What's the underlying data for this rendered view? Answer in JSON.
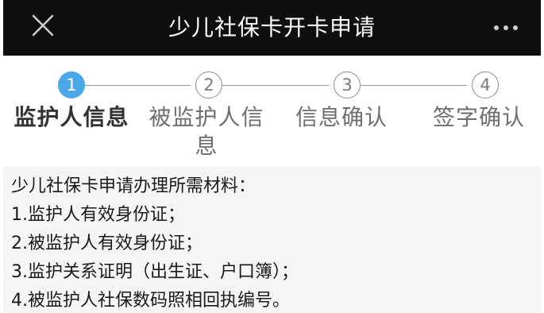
{
  "header": {
    "title": "少儿社保卡开卡申请",
    "close_icon": "close-icon",
    "more_icon": "more-horizontal-icon",
    "background": "#0f0f10"
  },
  "stepper": {
    "accent_color": "#4aa8e8",
    "steps": [
      {
        "number": "1",
        "label": "监护人信息",
        "active": true
      },
      {
        "number": "2",
        "label_line1": "被监护人信",
        "label_line2": "息",
        "active": false
      },
      {
        "number": "3",
        "label": "信息确认",
        "active": false
      },
      {
        "number": "4",
        "label": "签字确认",
        "active": false
      }
    ]
  },
  "materials": {
    "heading": "少儿社保卡申请办理所需材料：",
    "items": [
      "1.监护人有效身份证；",
      "2.被监护人有效身份证；",
      "3.监护关系证明（出生证、户口簿）；",
      "4.被监护人社保数码照相回执编号。"
    ],
    "background": "#f5f5f5"
  }
}
